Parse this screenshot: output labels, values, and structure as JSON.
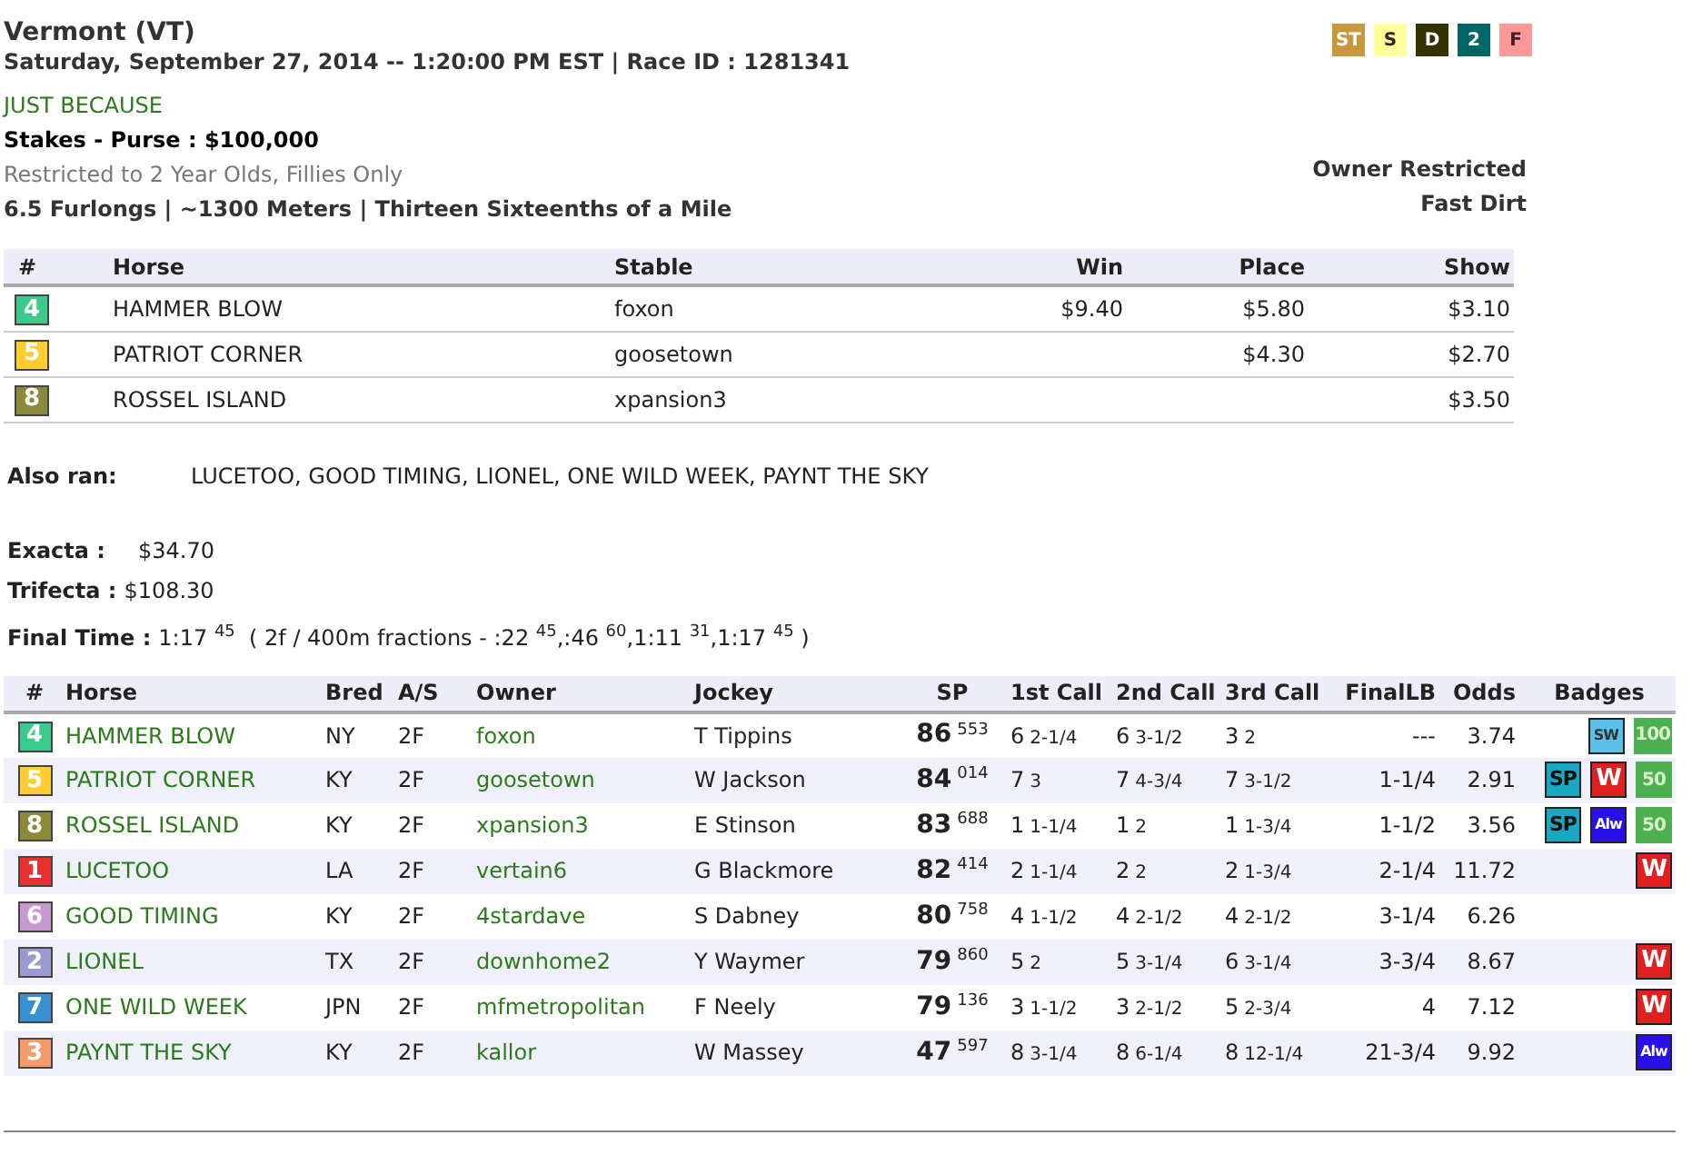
{
  "header": {
    "track": "Vermont (VT)",
    "datetime": "Saturday, September 27, 2014 -- 1:20:00 PM EST | Race ID : 1281341",
    "race_name": "JUST BECAUSE",
    "purse": "Stakes - Purse : $100,000",
    "restriction": "Restricted to 2 Year Olds, Fillies Only",
    "distance": "6.5 Furlongs | ~1300 Meters | Thirteen Sixteenths of a Mile",
    "owner_restriction": "Owner Restricted",
    "surface": "Fast Dirt"
  },
  "tags": [
    {
      "label": "ST",
      "color": "#c8963c"
    },
    {
      "label": "S",
      "color": "#ffff99"
    },
    {
      "label": "D",
      "color": "#333300"
    },
    {
      "label": "2",
      "color": "#006666"
    },
    {
      "label": "F",
      "color": "#ff9999"
    }
  ],
  "payouts": {
    "columns": [
      "#",
      "Horse",
      "Stable",
      "Win",
      "Place",
      "Show"
    ],
    "rows": [
      {
        "post": "4",
        "color": "#3cc98c",
        "horse": "HAMMER BLOW",
        "stable": "foxon",
        "win": "$9.40",
        "place": "$5.80",
        "show": "$3.10"
      },
      {
        "post": "5",
        "color": "#ffcc33",
        "horse": "PATRIOT CORNER",
        "stable": "goosetown",
        "place": "$4.30",
        "show": "$2.70"
      },
      {
        "post": "8",
        "color": "#8a8a3a",
        "horse": "ROSSEL ISLAND",
        "stable": "xpansion3",
        "show": "$3.50"
      }
    ]
  },
  "also_ran": {
    "label": "Also ran:",
    "value": "LUCETOO, GOOD TIMING, LIONEL, ONE WILD WEEK, PAYNT THE SKY"
  },
  "exotics": [
    {
      "label": "Exacta :",
      "value": "$34.70"
    },
    {
      "label": "Trifecta :",
      "value": "$108.30"
    }
  ],
  "final_time": {
    "label": "Final Time :",
    "value": "1:17 $^{45}$  ( 2f / 400m fractions - :22 $^{45}$,:46 $^{60}$,1:11 $^{31}$,1:17 $^{45}$ )"
  },
  "results": {
    "columns": [
      "#",
      "Horse",
      "Bred",
      "A/S",
      "Owner",
      "Jockey",
      "SP",
      "1st Call",
      "2nd Call",
      "3rd Call",
      "FinalLB",
      "Odds",
      "Badges"
    ],
    "rows": [
      {
        "post": "4",
        "color": "#3cc98c",
        "horse": "HAMMER BLOW",
        "bred": "NY",
        "as": "2F",
        "owner": "foxon",
        "jockey": "T Tippins",
        "sp": "86",
        "sp_sup": "553",
        "calls": [
          [
            "6",
            "2-1/4"
          ],
          [
            "6",
            "3-1/2"
          ],
          [
            "3",
            "2"
          ]
        ],
        "final_lb": "---",
        "odds": "3.74",
        "badges": [
          {
            "kind": "sw",
            "label": "SW"
          },
          {
            "kind": "green",
            "label": "100"
          }
        ]
      },
      {
        "post": "5",
        "color": "#ffcc33",
        "horse": "PATRIOT CORNER",
        "bred": "KY",
        "as": "2F",
        "owner": "goosetown",
        "jockey": "W Jackson",
        "sp": "84",
        "sp_sup": "014",
        "calls": [
          [
            "7",
            "3"
          ],
          [
            "7",
            "4-3/4"
          ],
          [
            "7",
            "3-1/2"
          ]
        ],
        "final_lb": "1-1/4",
        "odds": "2.91",
        "badges": [
          {
            "kind": "sp",
            "label": "SP"
          },
          {
            "kind": "w",
            "label": "W"
          },
          {
            "kind": "green",
            "label": "50"
          }
        ]
      },
      {
        "post": "8",
        "color": "#8a8a3a",
        "horse": "ROSSEL ISLAND",
        "bred": "KY",
        "as": "2F",
        "owner": "xpansion3",
        "jockey": "E Stinson",
        "sp": "83",
        "sp_sup": "688",
        "calls": [
          [
            "1",
            "1-1/4"
          ],
          [
            "1",
            "2"
          ],
          [
            "1",
            "1-3/4"
          ]
        ],
        "final_lb": "1-1/2",
        "odds": "3.56",
        "badges": [
          {
            "kind": "sp",
            "label": "SP"
          },
          {
            "kind": "alw",
            "label": "Alw"
          },
          {
            "kind": "green",
            "label": "50"
          }
        ]
      },
      {
        "post": "1",
        "color": "#e83030",
        "horse": "LUCETOO",
        "bred": "LA",
        "as": "2F",
        "owner": "vertain6",
        "jockey": "G Blackmore",
        "sp": "82",
        "sp_sup": "414",
        "calls": [
          [
            "2",
            "1-1/4"
          ],
          [
            "2",
            "2"
          ],
          [
            "2",
            "1-3/4"
          ]
        ],
        "final_lb": "2-1/4",
        "odds": "11.72",
        "badges": [
          {
            "kind": "w",
            "label": "W"
          }
        ]
      },
      {
        "post": "6",
        "color": "#c69ad0",
        "horse": "GOOD TIMING",
        "bred": "KY",
        "as": "2F",
        "owner": "4stardave",
        "jockey": "S Dabney",
        "sp": "80",
        "sp_sup": "758",
        "calls": [
          [
            "4",
            "1-1/2"
          ],
          [
            "4",
            "2-1/2"
          ],
          [
            "4",
            "2-1/2"
          ]
        ],
        "final_lb": "3-1/4",
        "odds": "6.26"
      },
      {
        "post": "2",
        "color": "#9a9ad0",
        "horse": "LIONEL",
        "bred": "TX",
        "as": "2F",
        "owner": "downhome2",
        "jockey": "Y Waymer",
        "sp": "79",
        "sp_sup": "860",
        "calls": [
          [
            "5",
            "2"
          ],
          [
            "5",
            "3-1/4"
          ],
          [
            "6",
            "3-1/4"
          ]
        ],
        "final_lb": "3-3/4",
        "odds": "8.67",
        "badges": [
          {
            "kind": "w",
            "label": "W"
          }
        ]
      },
      {
        "post": "7",
        "color": "#3a8fd0",
        "horse": "ONE WILD WEEK",
        "bred": "JPN",
        "as": "2F",
        "owner": "mfmetropolitan",
        "jockey": "F Neely",
        "sp": "79",
        "sp_sup": "136",
        "calls": [
          [
            "3",
            "1-1/2"
          ],
          [
            "3",
            "2-1/2"
          ],
          [
            "5",
            "2-3/4"
          ]
        ],
        "final_lb": "4",
        "odds": "7.12",
        "badges": [
          {
            "kind": "w",
            "label": "W"
          }
        ]
      },
      {
        "post": "3",
        "color": "#f59a6a",
        "horse": "PAYNT THE SKY",
        "bred": "KY",
        "as": "2F",
        "owner": "kallor",
        "jockey": "W Massey",
        "sp": "47",
        "sp_sup": "597",
        "calls": [
          [
            "8",
            "3-1/4"
          ],
          [
            "8",
            "6-1/4"
          ],
          [
            "8",
            "12-1/4"
          ]
        ],
        "final_lb": "21-3/4",
        "odds": "9.92",
        "badges": [
          {
            "kind": "alw",
            "label": "Alw"
          }
        ]
      }
    ]
  }
}
